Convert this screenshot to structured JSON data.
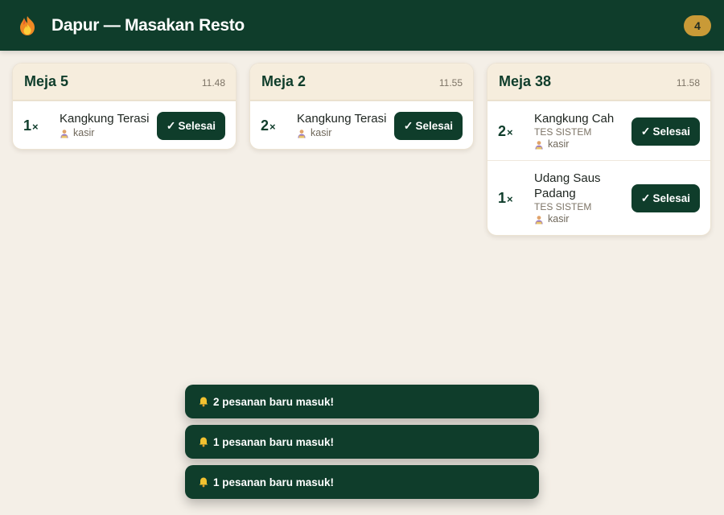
{
  "header": {
    "title": "Dapur — Masakan Resto",
    "logo_icon": "flame-icon",
    "order_count": "4",
    "colors": {
      "bar": "#0f3d2b",
      "badge": "#c99a37"
    }
  },
  "tables": [
    {
      "name": "Meja 5",
      "time": "11.48",
      "items": [
        {
          "qty": "1",
          "qty_suffix": "×",
          "name": "Kangkung Terasi",
          "note": "",
          "user": "kasir",
          "action": "Selesai"
        }
      ]
    },
    {
      "name": "Meja 2",
      "time": "11.55",
      "items": [
        {
          "qty": "2",
          "qty_suffix": "×",
          "name": "Kangkung Terasi",
          "note": "",
          "user": "kasir",
          "action": "Selesai"
        }
      ]
    },
    {
      "name": "Meja 38",
      "time": "11.58",
      "items": [
        {
          "qty": "2",
          "qty_suffix": "×",
          "name": "Kangkung Cah",
          "note": "TES SISTEM",
          "user": "kasir",
          "action": "Selesai"
        },
        {
          "qty": "1",
          "qty_suffix": "×",
          "name": "Udang Saus Padang",
          "note": "TES SISTEM",
          "user": "kasir",
          "action": "Selesai"
        }
      ]
    }
  ],
  "toasts": [
    {
      "text": "2 pesanan baru masuk!",
      "icon": "bell-icon"
    },
    {
      "text": "1 pesanan baru masuk!",
      "icon": "bell-icon"
    },
    {
      "text": "1 pesanan baru masuk!",
      "icon": "bell-icon"
    }
  ],
  "icons": {
    "check": "✓"
  }
}
